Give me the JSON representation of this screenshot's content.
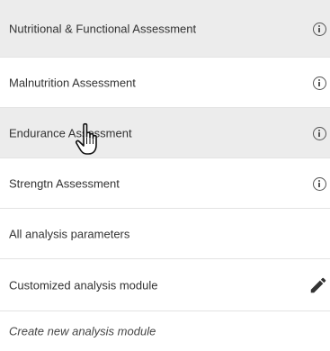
{
  "menu": {
    "items": [
      {
        "label": "Nutritional & Functional Assessment",
        "icon": "info-icon",
        "highlighted": true
      },
      {
        "label": "Malnutrition Assessment",
        "icon": "info-icon",
        "highlighted": false
      },
      {
        "label": "Endurance Assessment",
        "icon": "info-icon",
        "highlighted": true
      },
      {
        "label": "Strengtn Assessment",
        "icon": "info-icon",
        "highlighted": false
      },
      {
        "label": "All analysis parameters",
        "icon": "",
        "highlighted": false
      },
      {
        "label": "Customized analysis module",
        "icon": "pencil-icon",
        "highlighted": false
      },
      {
        "label": "Create new analysis module",
        "icon": "",
        "highlighted": false
      }
    ]
  },
  "cursor": {
    "type": "hand-pointer-icon"
  },
  "colors": {
    "highlight_bg": "#ececec",
    "divider": "#e3e3e3",
    "text": "#333333",
    "icon": "#555555"
  }
}
